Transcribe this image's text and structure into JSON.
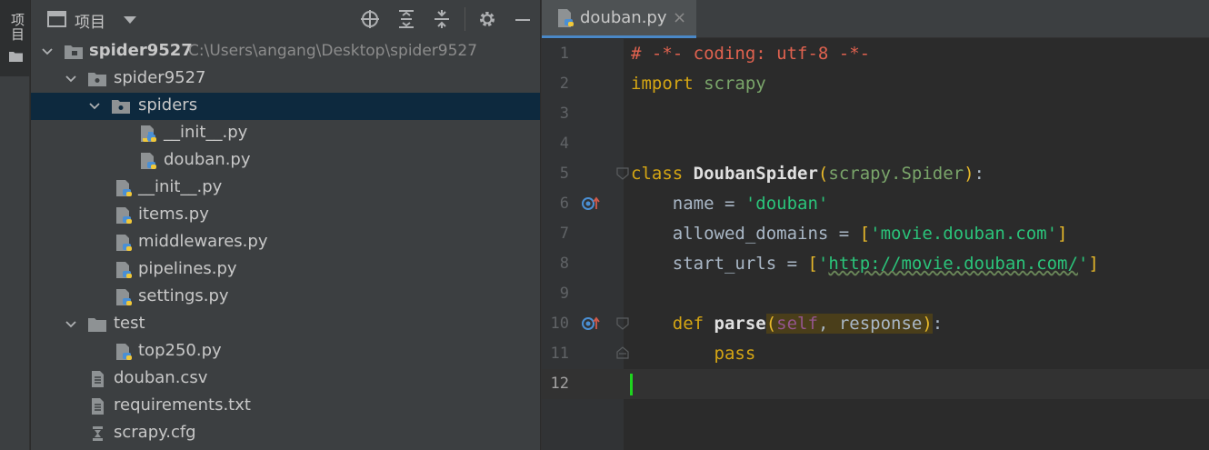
{
  "sidebar_strip": {
    "label": "项目"
  },
  "project_panel": {
    "title": "项目",
    "tree": [
      {
        "label": "spider9527",
        "path": "C:\\Users\\angang\\Desktop\\spider9527"
      },
      {
        "label": "spider9527"
      },
      {
        "label": "spiders"
      },
      {
        "label": "__init__.py"
      },
      {
        "label": "douban.py"
      },
      {
        "label": "__init__.py"
      },
      {
        "label": "items.py"
      },
      {
        "label": "middlewares.py"
      },
      {
        "label": "pipelines.py"
      },
      {
        "label": "settings.py"
      },
      {
        "label": "test"
      },
      {
        "label": "top250.py"
      },
      {
        "label": "douban.csv"
      },
      {
        "label": "requirements.txt"
      },
      {
        "label": "scrapy.cfg"
      }
    ]
  },
  "editor": {
    "tab": {
      "label": "douban.py",
      "close": "×"
    },
    "line_numbers": [
      "1",
      "2",
      "3",
      "4",
      "5",
      "6",
      "7",
      "8",
      "9",
      "10",
      "11",
      "12"
    ],
    "code": {
      "l1": "# -*- coding: utf-8 -*-",
      "l2_kw": "import",
      "l2_mod": " scrapy",
      "l5_kw": "class",
      "l5_name": " DoubanSpider",
      "l5_open": "(",
      "l5_base": "scrapy.Spider",
      "l5_close": ")",
      "l5_colon": ":",
      "l6_prop": "    name = ",
      "l6_str": "'douban'",
      "l7_prop": "    allowed_domains = ",
      "l7_open": "[",
      "l7_str": "'movie.douban.com'",
      "l7_close": "]",
      "l8_prop": "    start_urls = ",
      "l8_open": "[",
      "l8_q1": "'",
      "l8_url": "http://movie.douban.com/",
      "l8_q2": "'",
      "l8_close": "]",
      "l10_kw": "    def",
      "l10_name": " parse",
      "l10_open": "(",
      "l10_self": "self",
      "l10_rest": ", response",
      "l10_close": ")",
      "l10_colon": ":",
      "l11_kw": "        pass"
    }
  }
}
